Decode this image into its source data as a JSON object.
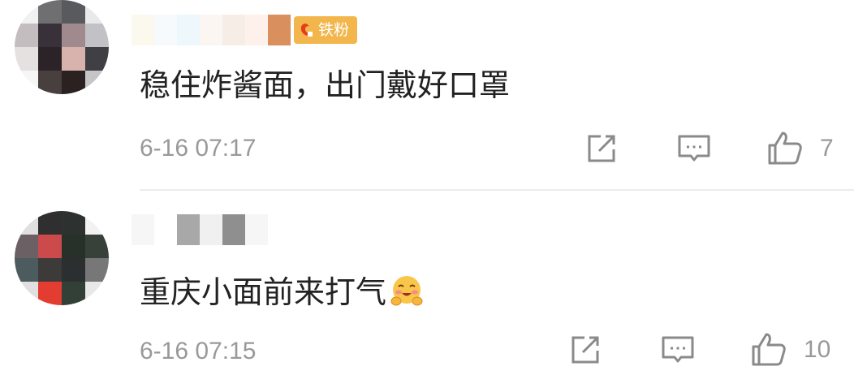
{
  "comments": [
    {
      "badge_label": "铁粉",
      "text": "稳住炸酱面，出门戴好口罩",
      "time": "6-16 07:17",
      "like_count": "7",
      "avatar_pixels": [
        "#f1f1f1",
        "#6f6f72",
        "#585a5e",
        "#e9e9ea",
        "#c4bdc0",
        "#39313a",
        "#a18a8d",
        "#c2c2c6",
        "#e6e1e1",
        "#2b2327",
        "#d8b2ac",
        "#3f3f44",
        "#f6f6f6",
        "#47403f",
        "#2b2121",
        "#c5c5c5"
      ],
      "username_pixels": [
        "#fbf9ee",
        "#f6fafc",
        "#eef8fc",
        "#fbf6f2",
        "#f5ede6",
        "#fef1ec",
        "#d98f5e"
      ]
    },
    {
      "text": "重庆小面前来打气",
      "time": "6-16 07:15",
      "like_count": "10",
      "emoji_name": "blush-hug-emoji",
      "avatar_pixels": [
        "#e0e0e0",
        "#2f2f2f",
        "#2d3230",
        "#f2f2f2",
        "#6b6064",
        "#cb4a4c",
        "#283129",
        "#374039",
        "#4c5b5d",
        "#3d3a3a",
        "#2b2f2f",
        "#777777",
        "#e0e0e0",
        "#e33c31",
        "#334038",
        "#e8e8e8"
      ],
      "username_pixels": [
        "#f6f6f6",
        "#ffffff",
        "#a8a8a8",
        "#f0f0f0",
        "#8f8f8f",
        "#f6f6f6"
      ]
    }
  ],
  "icons": {
    "share": "share-icon",
    "reply": "comment-icon",
    "like": "like-icon",
    "fan": "fan-badge-icon"
  },
  "colors": {
    "badge": "#f3b64c",
    "meta": "#999999",
    "text": "#222222"
  }
}
